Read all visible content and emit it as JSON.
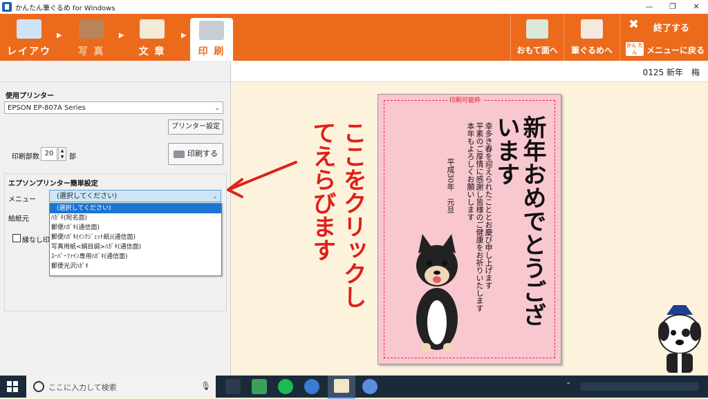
{
  "window": {
    "title": "かんたん筆ぐるめ for Windows",
    "controls": [
      "—",
      "❐",
      "✕"
    ]
  },
  "toolbar": {
    "steps": [
      {
        "label": "レイアウト",
        "icon": "layout-icon"
      },
      {
        "label": "写 真",
        "icon": "photo-icon"
      },
      {
        "label": "文 章",
        "icon": "text-icon"
      },
      {
        "label": "印 刷",
        "icon": "printer-icon"
      }
    ],
    "front_label": "おもて面へ",
    "fudegurume_label": "筆ぐるめへ",
    "exit_label": "終了する",
    "menu_back_label": "メニューに戻る",
    "menu_back_badge": "かん たん"
  },
  "doc_title": "0125 新年　梅",
  "printer": {
    "section_label": "使用プリンター",
    "selected": "EPSON EP-807A Series",
    "settings_button": "プリンター設定",
    "copies_label": "印刷部数",
    "copies_value": "20",
    "copies_unit": "部",
    "print_button": "印刷する"
  },
  "epson": {
    "section_label": "エプソンプリンター簡単設定",
    "menu_label": "メニュー",
    "menu_selected": "(選択してください)",
    "options": [
      "(選択してください)",
      "ﾊｶﾞｷ(宛名面)",
      "郵便ﾊｶﾞｷ(通信面)",
      "郵便ﾊｶﾞｷ(ｲﾝｸｼﾞｪｯﾄ紙)(通信面)",
      "写真用紙<絹目調>ﾊｶﾞｷ(通信面)",
      "ｽｰﾊﾟｰﾌｧｲﾝ専用ﾊｶﾞｷ(通信面)",
      "郵便光沢ﾊｶﾞｷ"
    ],
    "feed_label": "給紙元",
    "borderless_label": "縁なし印"
  },
  "annotation": {
    "text": "ここをクリックしてえらびます",
    "color": "#e0201a"
  },
  "card": {
    "printable_label": "印刷可能枠",
    "greeting": "新年おめでとうございます",
    "message_lines": [
      "幸多き春を迎えられたことと",
      "お慶び申し上げます",
      "平素のご厚情に感謝し",
      "皆様のご健康をお祈りいたします",
      "本年もよろしくお願いします"
    ],
    "date": "平成30年　元旦"
  },
  "taskbar": {
    "search_placeholder": "ここに入力して検索"
  },
  "colors": {
    "accent": "#ec6a1b",
    "card_pink": "#f9c7cf",
    "canvas": "#fdf3dc"
  }
}
